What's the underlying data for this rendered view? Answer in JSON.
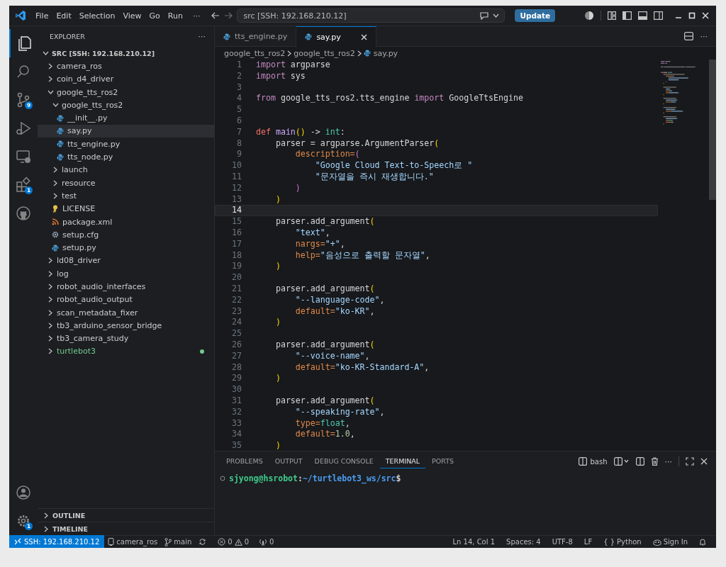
{
  "title_bar": {
    "menus": [
      "File",
      "Edit",
      "Selection",
      "View",
      "Go",
      "Run"
    ],
    "more": "···",
    "command_center": "src [SSH: 192.168.210.12]",
    "update_button": "Update"
  },
  "activity_bar": {
    "items": [
      {
        "kind": "explorer",
        "selected": true
      },
      {
        "kind": "search",
        "selected": false
      },
      {
        "kind": "source-control",
        "selected": false,
        "badge": "9"
      },
      {
        "kind": "run-debug",
        "selected": false
      },
      {
        "kind": "remote",
        "selected": false
      },
      {
        "kind": "extensions",
        "selected": false,
        "badge": "1"
      },
      {
        "kind": "github",
        "selected": false
      }
    ],
    "bottom": [
      {
        "kind": "account"
      },
      {
        "kind": "settings",
        "badge": "1"
      }
    ]
  },
  "explorer": {
    "title": "EXPLORER",
    "more": "···",
    "root": {
      "label": "SRC [SSH: 192.168.210.12]",
      "expanded": true
    },
    "tree": [
      {
        "label": "camera_ros",
        "kind": "folder",
        "expanded": false,
        "selected": false
      },
      {
        "label": "coin_d4_driver",
        "kind": "folder",
        "expanded": false,
        "selected": false
      },
      {
        "label": "google_tts_ros2",
        "kind": "folder",
        "expanded": true,
        "selected": false,
        "children": [
          {
            "label": "google_tts_ros2",
            "kind": "folder",
            "expanded": true,
            "selected": false,
            "children": [
              {
                "label": "__init__.py",
                "kind": "python",
                "selected": false
              },
              {
                "label": "say.py",
                "kind": "python",
                "selected": true
              },
              {
                "label": "tts_engine.py",
                "kind": "python",
                "selected": false
              },
              {
                "label": "tts_node.py",
                "kind": "python",
                "selected": false
              }
            ]
          },
          {
            "label": "launch",
            "kind": "folder",
            "expanded": false,
            "selected": false
          },
          {
            "label": "resource",
            "kind": "folder",
            "expanded": false,
            "selected": false
          },
          {
            "label": "test",
            "kind": "folder",
            "expanded": false,
            "selected": false
          },
          {
            "label": "LICENSE",
            "kind": "license",
            "selected": false
          },
          {
            "label": "package.xml",
            "kind": "xml",
            "selected": false
          },
          {
            "label": "setup.cfg",
            "kind": "config",
            "selected": false
          },
          {
            "label": "setup.py",
            "kind": "python",
            "selected": false
          }
        ]
      },
      {
        "label": "ld08_driver",
        "kind": "folder",
        "expanded": false,
        "selected": false
      },
      {
        "label": "log",
        "kind": "folder",
        "expanded": false,
        "selected": false
      },
      {
        "label": "robot_audio_interfaces",
        "kind": "folder",
        "expanded": false,
        "selected": false
      },
      {
        "label": "robot_audio_output",
        "kind": "folder",
        "expanded": false,
        "selected": false
      },
      {
        "label": "scan_metadata_fixer",
        "kind": "folder",
        "expanded": false,
        "selected": false
      },
      {
        "label": "tb3_arduino_sensor_bridge",
        "kind": "folder",
        "expanded": false,
        "selected": false
      },
      {
        "label": "tb3_camera_study",
        "kind": "folder",
        "expanded": false,
        "selected": false
      },
      {
        "label": "turtlebot3",
        "kind": "folder",
        "expanded": false,
        "selected": false,
        "color": "#73c991"
      }
    ],
    "sections": [
      {
        "label": "OUTLINE",
        "expanded": false
      },
      {
        "label": "TIMELINE",
        "expanded": false
      }
    ]
  },
  "tabs": [
    {
      "label": "tts_engine.py",
      "selected": false
    },
    {
      "label": "say.py",
      "selected": true
    }
  ],
  "editor_actions": {
    "more": "···"
  },
  "breadcrumbs": [
    {
      "label": "google_tts_ros2",
      "kind": "folder"
    },
    {
      "label": "google_tts_ros2",
      "kind": "folder"
    },
    {
      "label": "say.py",
      "kind": "python"
    }
  ],
  "code": [
    {
      "number": "1",
      "current": false,
      "tokens": [
        {
          "text": "import",
          "kind": "keyword"
        },
        {
          "text": " argparse",
          "kind": "plain"
        }
      ]
    },
    {
      "number": "2",
      "current": false,
      "tokens": [
        {
          "text": "import",
          "kind": "keyword"
        },
        {
          "text": " sys",
          "kind": "plain"
        }
      ]
    },
    {
      "number": "3",
      "current": false
    },
    {
      "number": "4",
      "current": false,
      "tokens": [
        {
          "text": "from",
          "kind": "keyword"
        },
        {
          "text": " google_tts_ros2.tts_engine ",
          "kind": "plain"
        },
        {
          "text": "import",
          "kind": "keyword"
        },
        {
          "text": " GoogleTtsEngine",
          "kind": "plain"
        }
      ]
    },
    {
      "number": "5",
      "current": false
    },
    {
      "number": "6",
      "current": false
    },
    {
      "number": "7",
      "current": false,
      "tokens": [
        {
          "text": "def ",
          "kind": "def"
        },
        {
          "text": "main",
          "kind": "function"
        },
        {
          "text": "()",
          "kind": "bracket1"
        },
        {
          "text": " -> ",
          "kind": "plain"
        },
        {
          "text": "int",
          "kind": "type"
        },
        {
          "text": ":",
          "kind": "plain"
        }
      ]
    },
    {
      "number": "8",
      "current": false,
      "tokens": [
        {
          "text": "    parser = argparse.ArgumentParser",
          "kind": "plain"
        },
        {
          "text": "(",
          "kind": "bracket1"
        }
      ]
    },
    {
      "number": "9",
      "current": false,
      "tokens": [
        {
          "text": "        description=",
          "kind": "param"
        },
        {
          "text": "(",
          "kind": "bracket2"
        }
      ]
    },
    {
      "number": "10",
      "current": false,
      "tokens": [
        {
          "text": "            \"Google Cloud Text-to-Speech로 \"",
          "kind": "string"
        }
      ]
    },
    {
      "number": "11",
      "current": false,
      "tokens": [
        {
          "text": "            \"문자열을 즉시 재생합니다.\"",
          "kind": "string"
        }
      ]
    },
    {
      "number": "12",
      "current": false,
      "tokens": [
        {
          "text": "        )",
          "kind": "bracket2"
        }
      ]
    },
    {
      "number": "13",
      "current": false,
      "tokens": [
        {
          "text": "    )",
          "kind": "bracket1"
        }
      ]
    },
    {
      "number": "14",
      "current": true
    },
    {
      "number": "15",
      "current": false,
      "tokens": [
        {
          "text": "    parser.add_argument",
          "kind": "plain"
        },
        {
          "text": "(",
          "kind": "bracket1"
        }
      ]
    },
    {
      "number": "16",
      "current": false,
      "tokens": [
        {
          "text": "        \"text\"",
          "kind": "string"
        },
        {
          "text": ",",
          "kind": "plain"
        }
      ]
    },
    {
      "number": "17",
      "current": false,
      "tokens": [
        {
          "text": "        nargs=",
          "kind": "param"
        },
        {
          "text": "\"+\"",
          "kind": "string"
        },
        {
          "text": ",",
          "kind": "plain"
        }
      ]
    },
    {
      "number": "18",
      "current": false,
      "tokens": [
        {
          "text": "        help=",
          "kind": "param"
        },
        {
          "text": "\"음성으로 출력할 문자열\"",
          "kind": "string"
        },
        {
          "text": ",",
          "kind": "plain"
        }
      ]
    },
    {
      "number": "19",
      "current": false,
      "tokens": [
        {
          "text": "    )",
          "kind": "bracket1"
        }
      ]
    },
    {
      "number": "20",
      "current": false
    },
    {
      "number": "21",
      "current": false,
      "tokens": [
        {
          "text": "    parser.add_argument",
          "kind": "plain"
        },
        {
          "text": "(",
          "kind": "bracket1"
        }
      ]
    },
    {
      "number": "22",
      "current": false,
      "tokens": [
        {
          "text": "        \"--language-code\"",
          "kind": "string"
        },
        {
          "text": ",",
          "kind": "plain"
        }
      ]
    },
    {
      "number": "23",
      "current": false,
      "tokens": [
        {
          "text": "        default=",
          "kind": "param"
        },
        {
          "text": "\"ko-KR\"",
          "kind": "string"
        },
        {
          "text": ",",
          "kind": "plain"
        }
      ]
    },
    {
      "number": "24",
      "current": false,
      "tokens": [
        {
          "text": "    )",
          "kind": "bracket1"
        }
      ]
    },
    {
      "number": "25",
      "current": false
    },
    {
      "number": "26",
      "current": false,
      "tokens": [
        {
          "text": "    parser.add_argument",
          "kind": "plain"
        },
        {
          "text": "(",
          "kind": "bracket1"
        }
      ]
    },
    {
      "number": "27",
      "current": false,
      "tokens": [
        {
          "text": "        \"--voice-name\"",
          "kind": "string"
        },
        {
          "text": ",",
          "kind": "plain"
        }
      ]
    },
    {
      "number": "28",
      "current": false,
      "tokens": [
        {
          "text": "        default=",
          "kind": "param"
        },
        {
          "text": "\"ko-KR-Standard-A\"",
          "kind": "string"
        },
        {
          "text": ",",
          "kind": "plain"
        }
      ]
    },
    {
      "number": "29",
      "current": false,
      "tokens": [
        {
          "text": "    )",
          "kind": "bracket1"
        }
      ]
    },
    {
      "number": "30",
      "current": false
    },
    {
      "number": "31",
      "current": false,
      "tokens": [
        {
          "text": "    parser.add_argument",
          "kind": "plain"
        },
        {
          "text": "(",
          "kind": "bracket1"
        }
      ]
    },
    {
      "number": "32",
      "current": false,
      "tokens": [
        {
          "text": "        \"--speaking-rate\"",
          "kind": "string"
        },
        {
          "text": ",",
          "kind": "plain"
        }
      ]
    },
    {
      "number": "33",
      "current": false,
      "tokens": [
        {
          "text": "        type=",
          "kind": "param"
        },
        {
          "text": "float",
          "kind": "type"
        },
        {
          "text": ",",
          "kind": "plain"
        }
      ]
    },
    {
      "number": "34",
      "current": false,
      "tokens": [
        {
          "text": "        default=",
          "kind": "param"
        },
        {
          "text": "1.0",
          "kind": "number"
        },
        {
          "text": ",",
          "kind": "plain"
        }
      ]
    },
    {
      "number": "35",
      "current": false,
      "tokens": [
        {
          "text": "    )",
          "kind": "bracket1"
        }
      ]
    }
  ],
  "panel": {
    "tabs": [
      {
        "label": "PROBLEMS",
        "selected": false
      },
      {
        "label": "OUTPUT",
        "selected": false
      },
      {
        "label": "DEBUG CONSOLE",
        "selected": false
      },
      {
        "label": "TERMINAL",
        "selected": true
      },
      {
        "label": "PORTS",
        "selected": false
      }
    ],
    "terminal_name": "bash",
    "more": "···",
    "prompt": [
      {
        "text": "sjyong@hsrobot",
        "kind": "user"
      },
      {
        "text": ":",
        "kind": "plain"
      },
      {
        "text": "~/turtlebot3_ws/src",
        "kind": "path"
      },
      {
        "text": "$",
        "kind": "plain"
      }
    ]
  },
  "status_bar": {
    "remote": "SSH: 192.168.210.12",
    "left": [
      {
        "kind": "device",
        "text": "camera_ros"
      },
      {
        "kind": "branch",
        "text": "main"
      },
      {
        "kind": "sync"
      },
      {
        "kind": "errors",
        "text": "0"
      },
      {
        "kind": "warnings",
        "text": "0"
      },
      {
        "kind": "ports",
        "text": "0"
      }
    ],
    "right": [
      {
        "kind": "text",
        "text": "Ln 14, Col 1"
      },
      {
        "kind": "text",
        "text": "Spaces: 4"
      },
      {
        "kind": "text",
        "text": "UTF-8"
      },
      {
        "kind": "text",
        "text": "LF"
      },
      {
        "kind": "language",
        "braces": "{ }",
        "text": "Python"
      },
      {
        "kind": "account",
        "text": "Sign In"
      },
      {
        "kind": "bell"
      }
    ]
  }
}
